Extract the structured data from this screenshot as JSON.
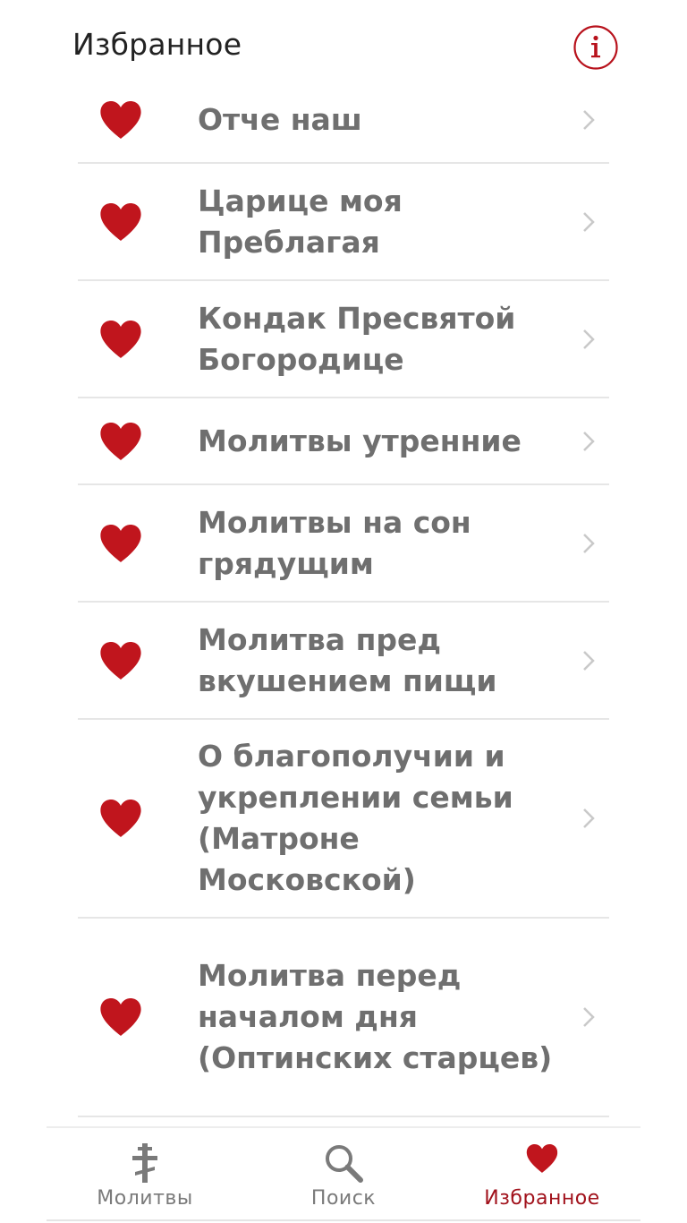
{
  "header": {
    "title": "Избранное",
    "info_icon": "info-icon"
  },
  "favorites": [
    {
      "label": "Отче наш"
    },
    {
      "label": "Царице моя Преблагая"
    },
    {
      "label": "Кондак Пресвятой Богородице"
    },
    {
      "label": "Молитвы утренние"
    },
    {
      "label": "Молитвы на сон грядущим"
    },
    {
      "label": "Молитва пред вкушением пищи"
    },
    {
      "label": "О благополучии и укреплении семьи (Матроне Московской)"
    },
    {
      "label": "Молитва перед началом дня (Оптинских старцев)"
    }
  ],
  "tabbar": {
    "tabs": [
      {
        "label": "Молитвы",
        "icon": "orthodox-cross-icon",
        "active": false
      },
      {
        "label": "Поиск",
        "icon": "search-icon",
        "active": false
      },
      {
        "label": "Избранное",
        "icon": "heart-icon",
        "active": true
      }
    ]
  },
  "colors": {
    "accent": "#a1111b",
    "heart": "#c0151d",
    "item_text": "#6f6f6f",
    "divider": "#e6e6e6"
  }
}
